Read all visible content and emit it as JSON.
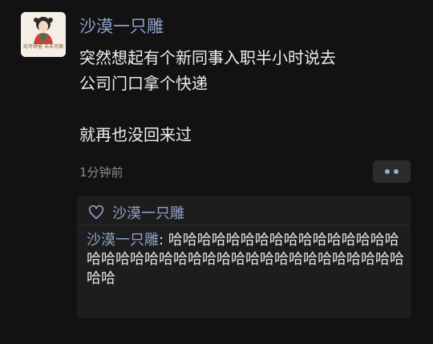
{
  "avatar": {
    "caption": "尚可婷留 未未可嫁"
  },
  "post": {
    "author": "沙漠一只雕",
    "content": "突然想起有个新同事入职半小时说去\n公司门口拿个快递\n\n就再也没回来过",
    "time": "1分钟前"
  },
  "likes": {
    "names": "沙漠一只雕"
  },
  "comment": {
    "author": "沙漠一只雕",
    "separator": ": ",
    "text": "哈哈哈哈哈哈哈哈哈哈哈哈哈哈哈哈哈哈哈哈哈哈哈哈哈哈哈哈哈哈哈哈哈哈哈哈哈哈哈哈"
  }
}
